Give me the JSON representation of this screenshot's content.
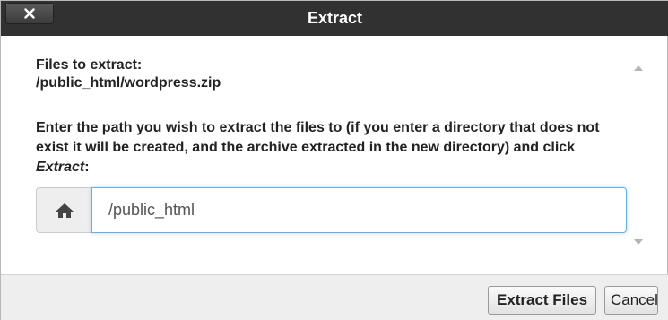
{
  "dialog": {
    "title": "Extract",
    "close_icon": "close-x-icon"
  },
  "content": {
    "files_label": "Files to extract:",
    "file_path": "/public_html/wordpress.zip",
    "instruction_text": "Enter the path you wish to extract the files to (if you enter a directory that does not exist it will be created, and the archive extracted in the new directory) and click ",
    "instruction_emphasis": "Extract",
    "instruction_tail": ":",
    "home_icon": "home-icon",
    "path_value": "/public_html"
  },
  "footer": {
    "extract_label": "Extract Files",
    "cancel_label": "Cancel"
  }
}
